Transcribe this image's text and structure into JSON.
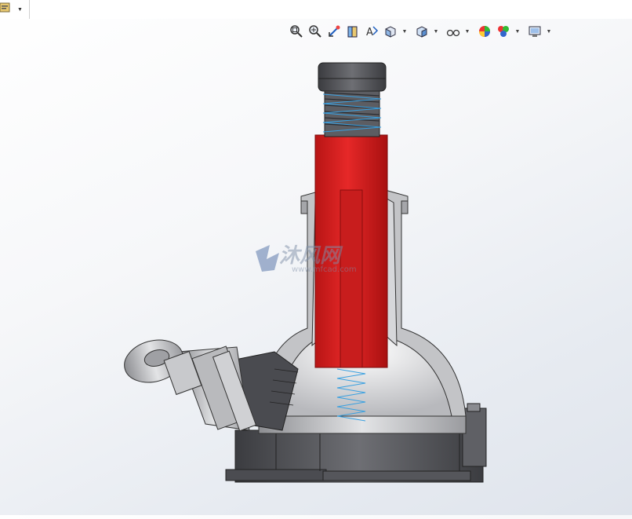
{
  "toolbar": {
    "menu_icon": "document-properties-icon",
    "view_tools": [
      {
        "name": "zoom-to-fit-icon"
      },
      {
        "name": "zoom-to-area-icon"
      },
      {
        "name": "previous-view-icon"
      },
      {
        "name": "section-view-icon"
      },
      {
        "name": "dynamic-annotation-icon"
      },
      {
        "name": "view-orientation-icon",
        "dropdown": true
      },
      {
        "name": "display-style-icon",
        "dropdown": true
      },
      {
        "name": "hide-show-items-icon",
        "dropdown": true
      },
      {
        "name": "edit-appearance-icon"
      },
      {
        "name": "apply-scene-icon",
        "dropdown": true
      },
      {
        "name": "view-settings-icon",
        "dropdown": true
      }
    ]
  },
  "watermark": {
    "text": "沐风网",
    "url": "www.mfcad.com"
  },
  "colors": {
    "red_part": "#d61f1f",
    "housing": "#c9c9cb",
    "base": "#4a4b50",
    "spring": "#3aa0e0"
  }
}
